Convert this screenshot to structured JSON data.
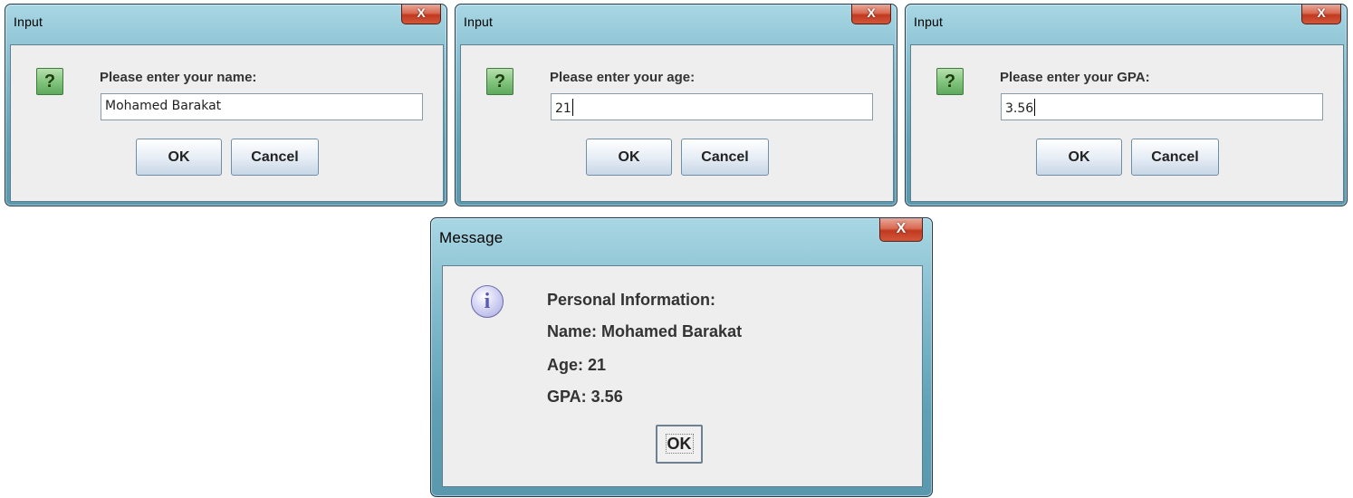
{
  "dialogs": {
    "name": {
      "title": "Input",
      "prompt": "Please enter your name:",
      "value": "Mohamed Barakat",
      "ok_label": "OK",
      "cancel_label": "Cancel",
      "close_label": "X",
      "icon": "question-icon"
    },
    "age": {
      "title": "Input",
      "prompt": "Please enter your age:",
      "value": "21",
      "ok_label": "OK",
      "cancel_label": "Cancel",
      "close_label": "X",
      "icon": "question-icon"
    },
    "gpa": {
      "title": "Input",
      "prompt": "Please enter your GPA:",
      "value": "3.56",
      "ok_label": "OK",
      "cancel_label": "Cancel",
      "close_label": "X",
      "icon": "question-icon"
    },
    "message": {
      "title": "Message",
      "close_label": "X",
      "icon": "information-icon",
      "lines": [
        "Personal Information:",
        "Name: Mohamed Barakat",
        "Age: 21",
        "GPA: 3.56"
      ],
      "ok_label": "OK"
    }
  },
  "icon_glyphs": {
    "question": "?",
    "information": "i"
  },
  "colors": {
    "frame_accent": "#5fa0b5",
    "close_button": "#c0391f",
    "client_background": "#eeeeee",
    "question_icon": "#7ec27a",
    "info_icon": "#a8a8e0"
  }
}
